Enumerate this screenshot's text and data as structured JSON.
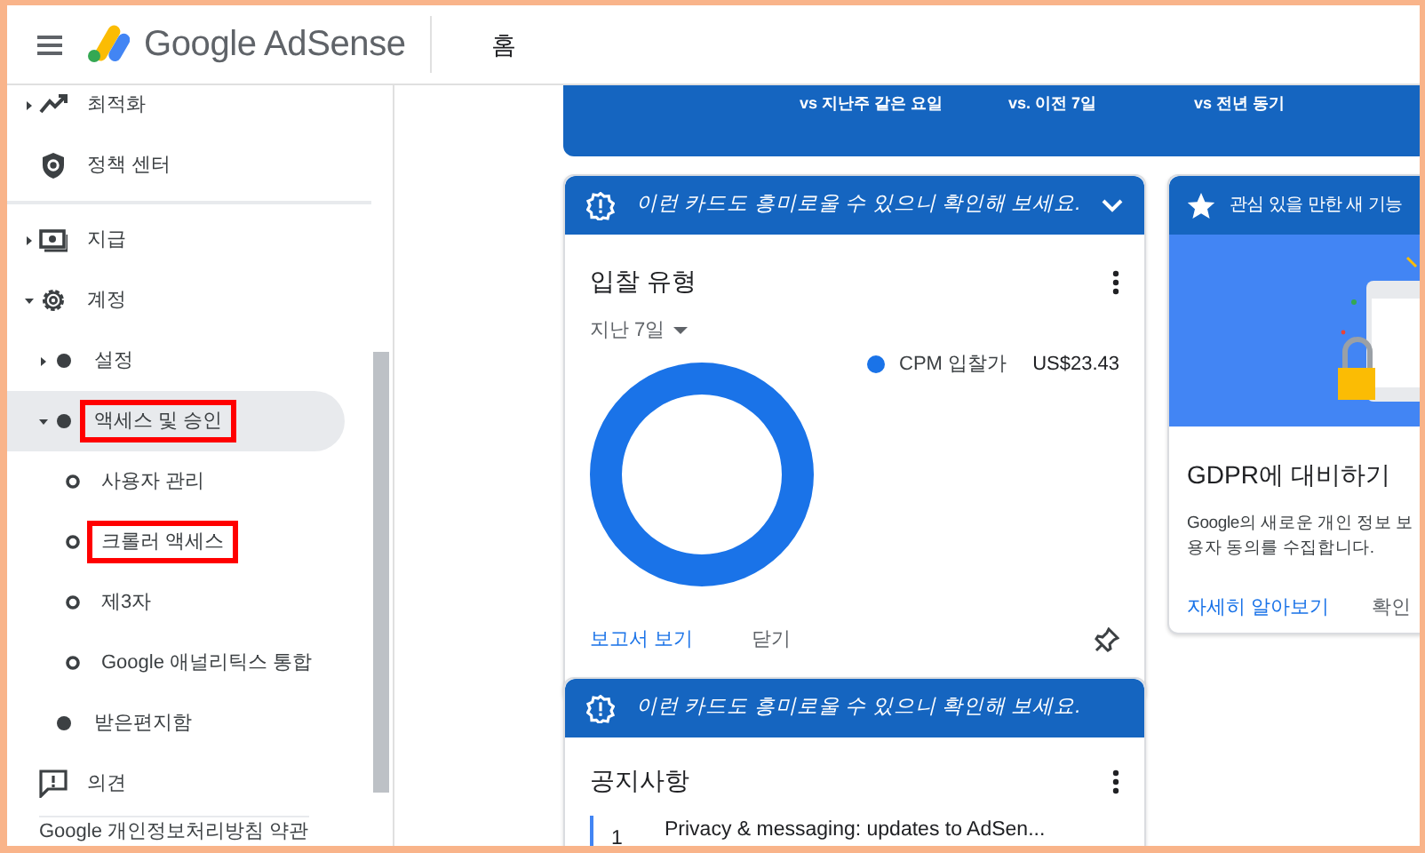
{
  "header": {
    "logo_text": "Google AdSense",
    "page_title": "홈"
  },
  "sidebar": {
    "sections": [
      {
        "items": [
          {
            "label": "최적화",
            "expanded": false,
            "selected": false,
            "highlighted": false
          },
          {
            "label": "정책 센터",
            "selected": false,
            "highlighted": false
          }
        ]
      },
      {
        "items": [
          {
            "label": "지급",
            "expanded": false,
            "selected": false,
            "highlighted": false
          },
          {
            "label": "계정",
            "expanded": true,
            "selected": false,
            "highlighted": false,
            "children": [
              {
                "label": "설정",
                "expanded": false,
                "selected": false,
                "highlighted": false
              },
              {
                "label": "액세스 및 승인",
                "expanded": true,
                "selected": true,
                "highlighted": true,
                "children": [
                  {
                    "label": "사용자 관리",
                    "selected": false,
                    "highlighted": false
                  },
                  {
                    "label": "크롤러 액세스",
                    "selected": false,
                    "highlighted": true
                  },
                  {
                    "label": "제3자",
                    "selected": false,
                    "highlighted": false
                  },
                  {
                    "label": "Google 애널리틱스 통합",
                    "selected": false,
                    "highlighted": false
                  }
                ]
              },
              {
                "label": "받은편지함",
                "selected": false,
                "highlighted": false
              }
            ]
          },
          {
            "label": "의견",
            "selected": false,
            "highlighted": false
          }
        ]
      }
    ],
    "footer": "Google 개인정보처리방침 약관"
  },
  "summary_card": {
    "comparisons": [
      "vs 지난주 같은 요일",
      "vs. 이전 7일",
      "vs 전년 동기"
    ]
  },
  "bid_card": {
    "banner": "이런 카드도 흥미로울 수 있으니 확인해 보세요.",
    "title": "입찰 유형",
    "period": "지난 7일",
    "legend": [
      {
        "label": "CPM 입찰가",
        "value": "US$23.43"
      }
    ],
    "actions": [
      "보고서 보기",
      "닫기"
    ]
  },
  "notice_card": {
    "banner": "이런 카드도 흥미로울 수 있으니 확인해 보세요.",
    "title": "공지사항",
    "items": [
      {
        "number": "1",
        "text": "Privacy & messaging: updates to AdSen..."
      }
    ]
  },
  "feature_card": {
    "banner": "관심 있을 만한 새 기능",
    "title": "GDPR에 대비하기",
    "text": "Google의 새로운 개인 정보 보\n용자 동의를 수집합니다.",
    "actions": [
      "자세히 알아보기",
      "확인"
    ]
  }
}
